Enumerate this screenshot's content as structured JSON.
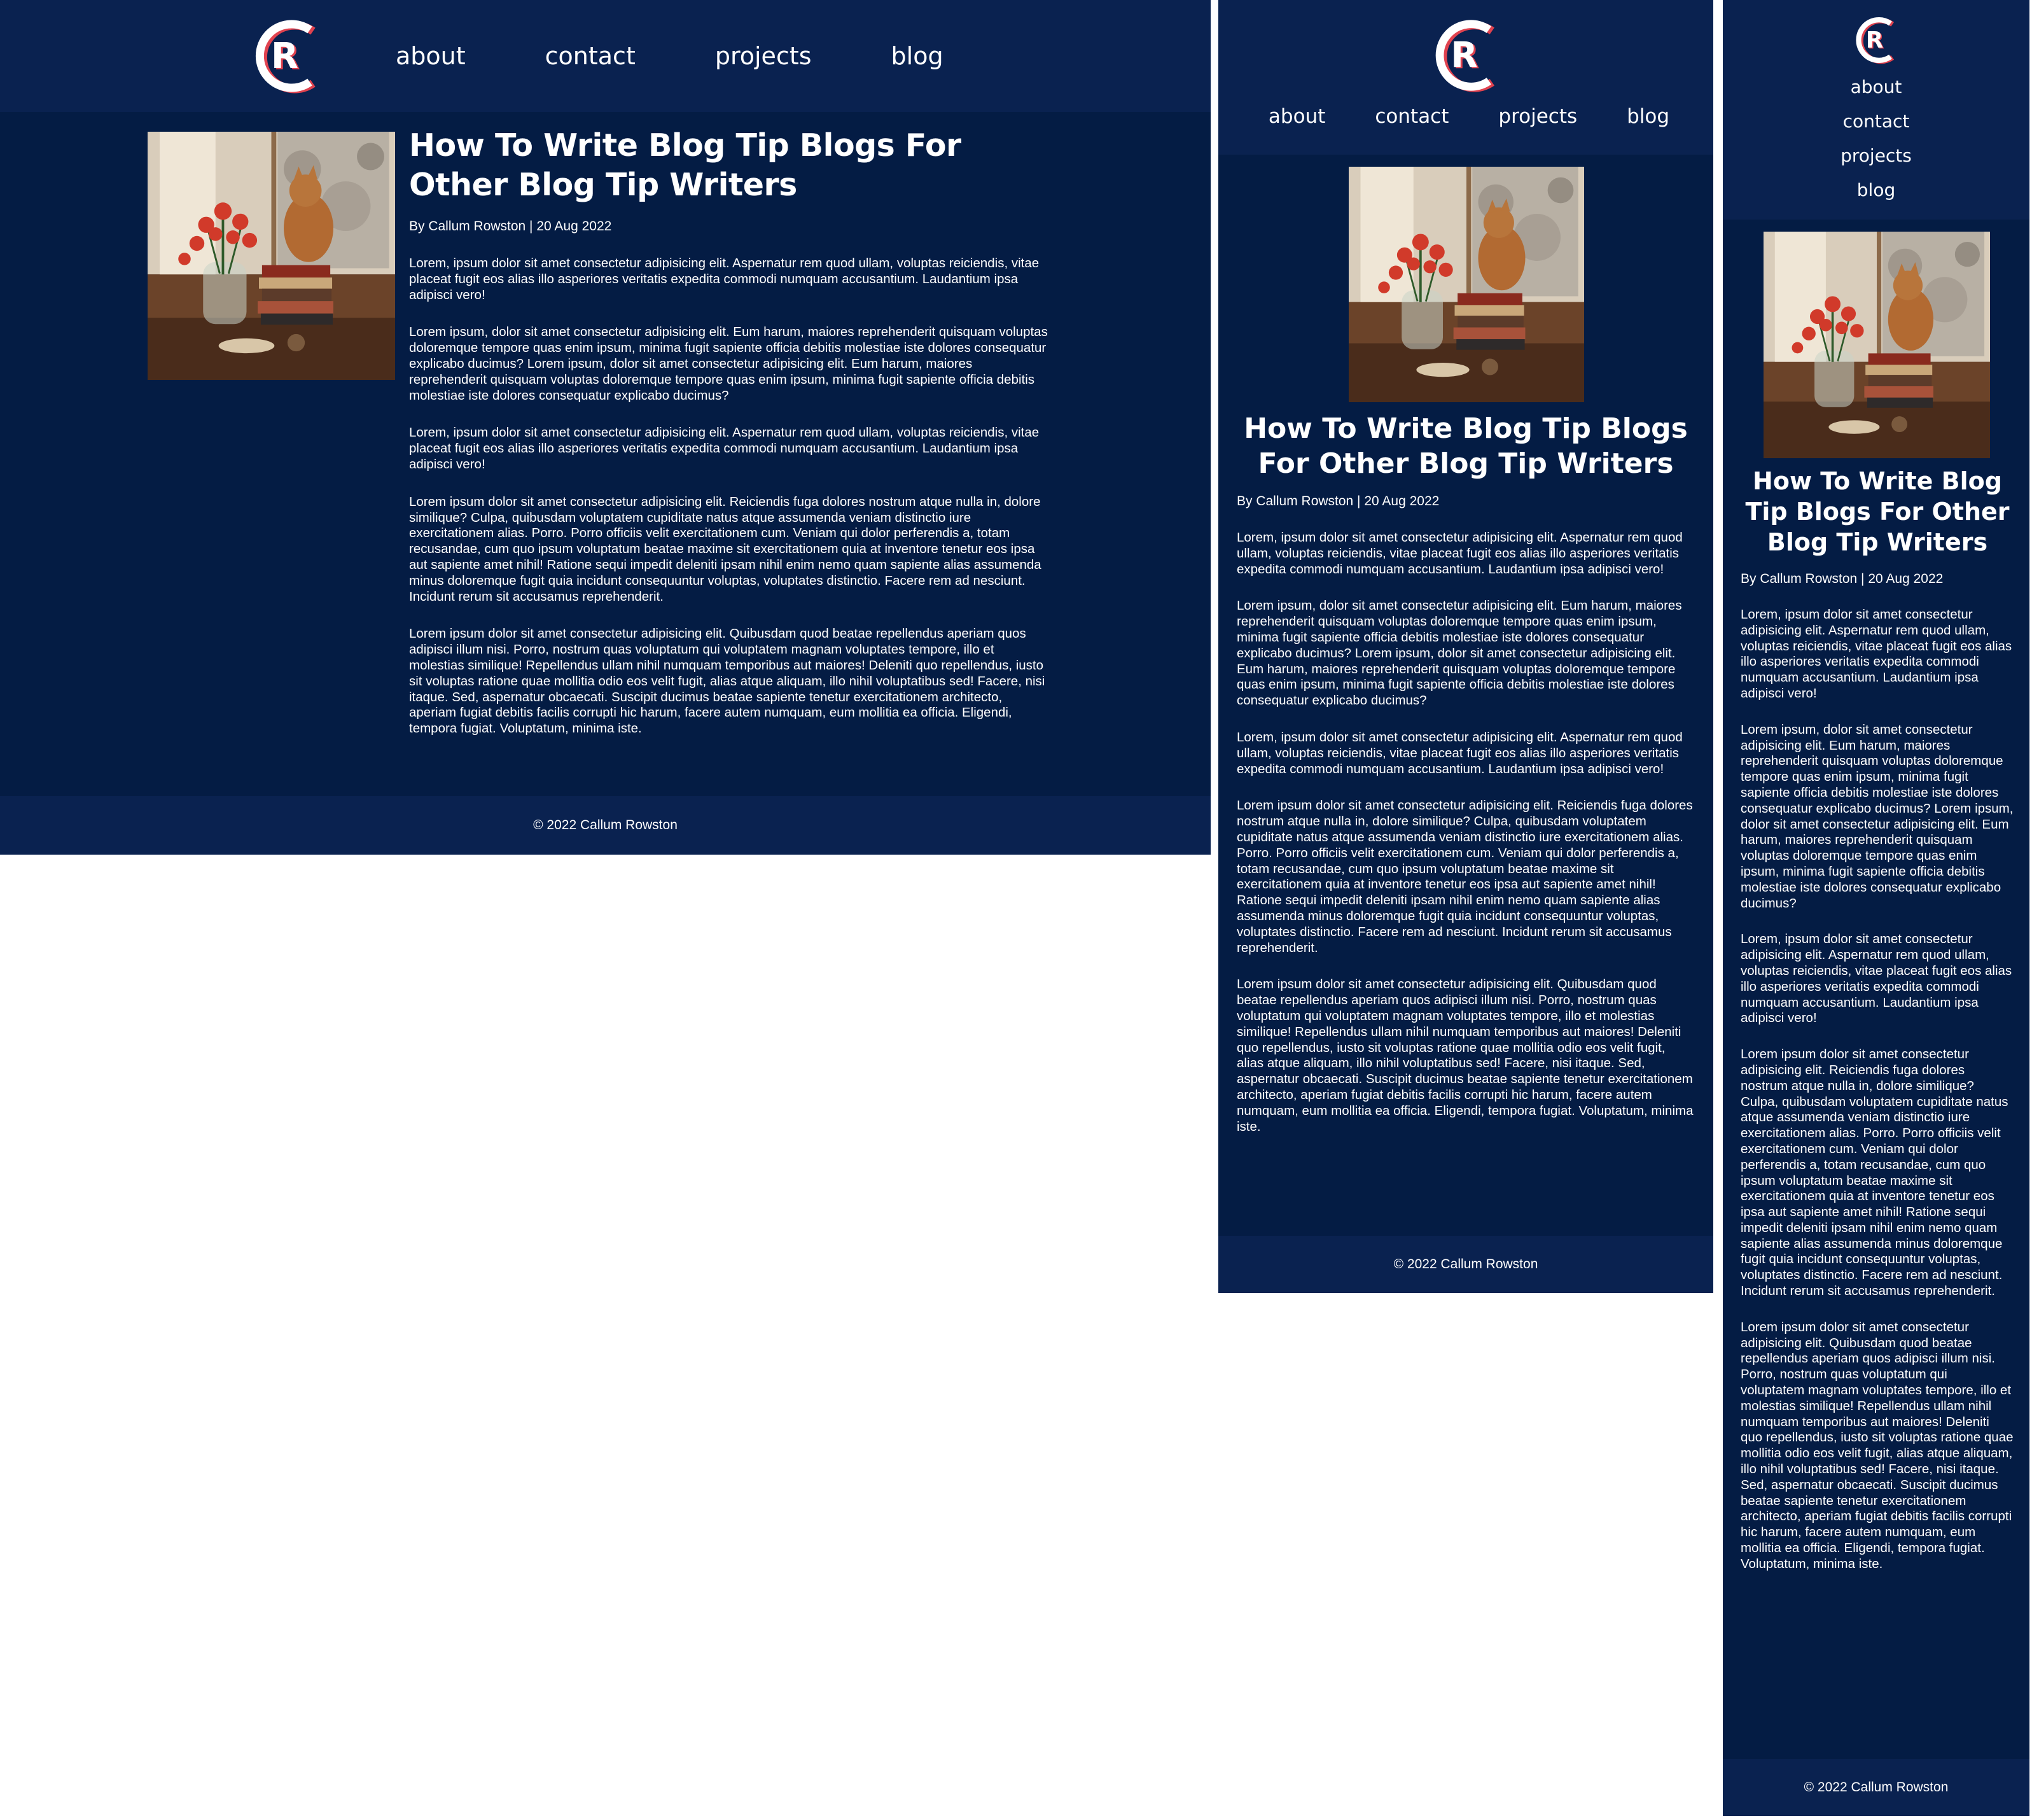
{
  "brand": {
    "logo_letters": "CR",
    "logo_colors": {
      "outer": "#ffffff",
      "shadow": "#e0424f",
      "letter": "#ffffff"
    }
  },
  "colors": {
    "page_bg": "#041c44",
    "header_bg": "#0a2250",
    "text": "#ffffff"
  },
  "nav": {
    "items": [
      {
        "label": "about"
      },
      {
        "label": "contact"
      },
      {
        "label": "projects"
      },
      {
        "label": "blog"
      }
    ]
  },
  "post": {
    "title": "How To Write Blog Tip Blogs For Other Blog Tip Writers",
    "byline": "By Callum Rowston | 20 Aug 2022",
    "image_icon": "cat-flowers-window-photo",
    "desktop_paragraphs": [
      "Lorem, ipsum dolor sit amet consectetur adipisicing elit. Aspernatur rem quod ullam, voluptas reiciendis, vitae placeat fugit eos alias illo asperiores veritatis expedita commodi numquam accusantium. Laudantium ipsa adipisci vero!",
      "Lorem ipsum, dolor sit amet consectetur adipisicing elit. Eum harum, maiores reprehenderit quisquam voluptas doloremque tempore quas enim ipsum, minima fugit sapiente officia debitis molestiae iste dolores consequatur explicabo ducimus? Lorem ipsum, dolor sit amet consectetur adipisicing elit. Eum harum, maiores reprehenderit quisquam voluptas doloremque tempore quas enim ipsum, minima fugit sapiente officia debitis molestiae iste dolores consequatur explicabo ducimus?",
      "Lorem, ipsum dolor sit amet consectetur adipisicing elit. Aspernatur rem quod ullam, voluptas reiciendis, vitae placeat fugit eos alias illo asperiores veritatis expedita commodi numquam accusantium. Laudantium ipsa adipisci vero!",
      "Lorem ipsum dolor sit amet consectetur adipisicing elit. Reiciendis fuga dolores nostrum atque nulla in, dolore similique? Culpa, quibusdam voluptatem cupiditate natus atque assumenda veniam distinctio iure exercitationem alias. Porro. Porro officiis velit exercitationem cum. Veniam qui dolor perferendis a, totam recusandae, cum quo ipsum voluptatum beatae maxime sit exercitationem quia at inventore tenetur eos ipsa aut sapiente amet nihil! Ratione sequi impedit deleniti ipsam nihil enim nemo quam sapiente alias assumenda minus doloremque fugit quia incidunt consequuntur voluptas, voluptates distinctio. Facere rem ad nesciunt. Incidunt rerum sit accusamus reprehenderit.",
      "Lorem ipsum dolor sit amet consectetur adipisicing elit. Quibusdam quod beatae repellendus aperiam quos adipisci illum nisi. Porro, nostrum quas voluptatum qui voluptatem magnam voluptates tempore, illo et molestias similique! Repellendus ullam nihil numquam temporibus aut maiores! Deleniti quo repellendus, iusto sit voluptas ratione quae mollitia odio eos velit fugit, alias atque aliquam, illo nihil voluptatibus sed! Facere, nisi itaque. Sed, aspernatur obcaecati. Suscipit ducimus beatae sapiente tenetur exercitationem architecto, aperiam fugiat debitis facilis corrupti hic harum, facere autem numquam, eum mollitia ea officia. Eligendi, tempora fugiat. Voluptatum, minima iste."
    ],
    "paragraphs": [
      "Lorem, ipsum dolor sit amet consectetur adipisicing elit. Aspernatur rem quod ullam, voluptas reiciendis, vitae placeat fugit eos alias illo asperiores veritatis expedita commodi numquam accusantium. Laudantium ipsa adipisci vero!",
      "Lorem ipsum, dolor sit amet consectetur adipisicing elit. Eum harum, maiores reprehenderit quisquam voluptas doloremque tempore quas enim ipsum, minima fugit sapiente officia debitis molestiae iste dolores consequatur explicabo ducimus? Lorem ipsum, dolor sit amet consectetur adipisicing elit. Eum harum, maiores reprehenderit quisquam voluptas doloremque tempore quas enim ipsum, minima fugit sapiente officia debitis molestiae iste dolores consequatur explicabo ducimus?",
      "Lorem, ipsum dolor sit amet consectetur adipisicing elit. Aspernatur rem quod ullam, voluptas reiciendis, vitae placeat fugit eos alias illo asperiores veritatis expedita commodi numquam accusantium. Laudantium ipsa adipisci vero!",
      "Lorem ipsum dolor sit amet consectetur adipisicing elit. Reiciendis fuga dolores nostrum atque nulla in, dolore similique? Culpa, quibusdam voluptatem cupiditate natus atque assumenda veniam distinctio iure exercitationem alias. Porro. Porro officiis velit exercitationem cum. Veniam qui dolor perferendis a, totam recusandae, cum quo ipsum voluptatum beatae maxime sit exercitationem quia at inventore tenetur eos ipsa aut sapiente amet nihil! Ratione sequi impedit deleniti ipsam nihil enim nemo quam sapiente alias assumenda minus doloremque fugit quia incidunt consequuntur voluptas, voluptates distinctio. Facere rem ad nesciunt. Incidunt rerum sit accusamus reprehenderit.",
      "Lorem ipsum dolor sit amet consectetur adipisicing elit. Quibusdam quod beatae repellendus aperiam quos adipisci illum nisi. Porro, nostrum quas voluptatum qui voluptatem magnam voluptates tempore, illo et molestias similique! Repellendus ullam nihil numquam temporibus aut maiores! Deleniti quo repellendus, iusto sit voluptas ratione quae mollitia odio eos velit fugit, alias atque aliquam, illo nihil voluptatibus sed! Facere, nisi itaque. Sed, aspernatur obcaecati. Suscipit ducimus beatae sapiente tenetur exercitationem architecto, aperiam fugiat debitis facilis corrupti hic harum, facere autem numquam, eum mollitia ea officia. Eligendi, tempora fugiat. Voluptatum, minima iste."
    ]
  },
  "footer": {
    "copyright": "© 2022 Callum Rowston"
  }
}
